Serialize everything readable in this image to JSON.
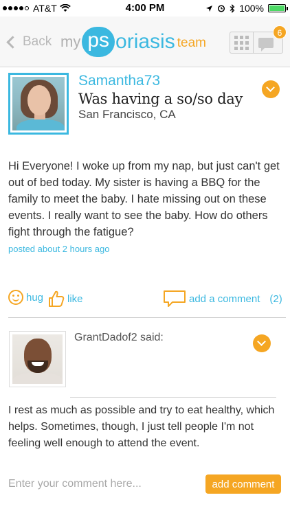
{
  "status_bar": {
    "carrier": "AT&T",
    "time": "4:00 PM",
    "battery": "100%"
  },
  "nav": {
    "back_label": "Back",
    "logo_my": "my",
    "logo_ps": "ps",
    "logo_oriasis": "oriasis",
    "logo_team": "team",
    "notification_count": "6"
  },
  "post": {
    "username": "Samantha73",
    "mood": "Was having a so/so day",
    "location": "San Francisco, CA",
    "body": "Hi Everyone! I woke up from my nap, but just can't get out of bed today. My sister is having a BBQ for the family to meet the baby. I hate missing out on these events. I really want to see the baby. How do others fight through the fatigue?",
    "timestamp": "posted about 2 hours ago"
  },
  "actions": {
    "hug_label": "hug",
    "like_label": "like",
    "comment_label": "add a comment",
    "comment_count": "(2)"
  },
  "reply": {
    "author_line": "GrantDadof2 said:",
    "body": "I rest as much as possible and try to eat healthy, which helps. Sometimes, though, I just tell people I'm not feeling well enough to attend the event."
  },
  "comment_box": {
    "placeholder": "Enter your comment here...",
    "submit_label": "add comment"
  },
  "colors": {
    "accent_blue": "#3bb8e0",
    "accent_orange": "#f5a623"
  }
}
